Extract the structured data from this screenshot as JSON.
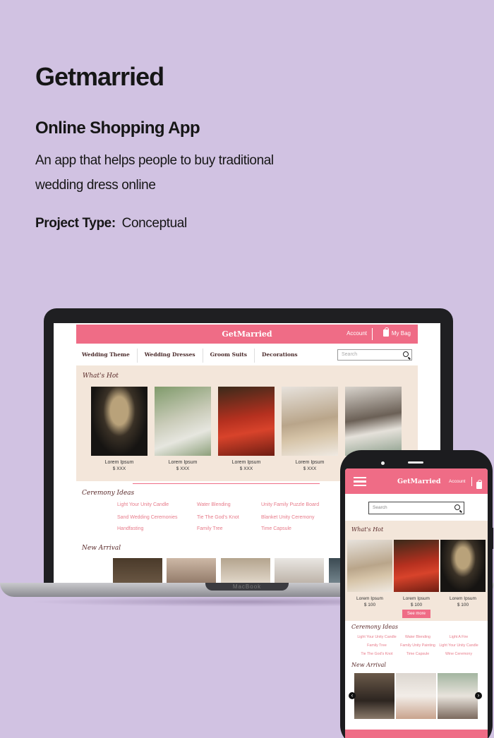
{
  "headline": {
    "title": "Getmarried",
    "subtitle": "Online Shopping App",
    "description": "An app that helps people to buy traditional wedding dress online",
    "project_type_label": "Project Type:",
    "project_type_value": "Conceptual"
  },
  "laptop": {
    "brand_label": "MacBook",
    "header": {
      "logo": "GetMarried",
      "account": "Account",
      "bag": "My Bag"
    },
    "nav": [
      "Wedding Theme",
      "Wedding Dresses",
      "Groom Suits",
      "Decorations"
    ],
    "search_placeholder": "Search",
    "whats_hot": {
      "title": "What's Hot",
      "products": [
        {
          "name": "Lorem Ipsum",
          "price": "$    XXX"
        },
        {
          "name": "Lorem Ipsum",
          "price": "$    XXX"
        },
        {
          "name": "Lorem Ipsum",
          "price": "$    XXX"
        },
        {
          "name": "Lorem Ipsum",
          "price": "$    XXX"
        }
      ]
    },
    "ceremony": {
      "title": "Ceremony Ideas",
      "items": [
        "Light Your Unity Candle",
        "Water Blending",
        "Unity Family Puzzle Board",
        "Sand Wedding Ceremonies",
        "Tie The God's Knot",
        "Blanket Unity Ceremony",
        "Handfasting",
        "Family Tree",
        "Time Capsule"
      ]
    },
    "new_arrival": {
      "title": "New Arrival"
    }
  },
  "phone": {
    "header": {
      "logo": "GetMarried",
      "account": "Account"
    },
    "search_placeholder": "Search",
    "whats_hot": {
      "title": "What's Hot",
      "products": [
        {
          "name": "Lorem Ipsum",
          "price": "$ 100"
        },
        {
          "name": "Lorem Ipsum",
          "price": "$ 100"
        },
        {
          "name": "Lorem Ipsum",
          "price": "$ 100"
        }
      ],
      "see_more": "See more"
    },
    "ceremony": {
      "title": "Ceremony Ideas",
      "items": [
        "Light Your Unity Candle",
        "Water Blending",
        "Light A Fire",
        "Family Tree",
        "Family Unity Painting",
        "Light Your Unity Candle",
        "Tie The God's Knot",
        "Time Capsule",
        "Wine Ceremony"
      ]
    },
    "new_arrival": {
      "title": "New Arrival"
    }
  },
  "colors": {
    "background": "#d1c2e2",
    "brand_pink": "#ef6c86",
    "hot_bg": "#f3e6da",
    "link_pink": "#e77b8a"
  },
  "icons": [
    "shopping-bag-icon",
    "search-icon",
    "hamburger-menu-icon",
    "arrow-left-icon",
    "arrow-right-icon"
  ]
}
